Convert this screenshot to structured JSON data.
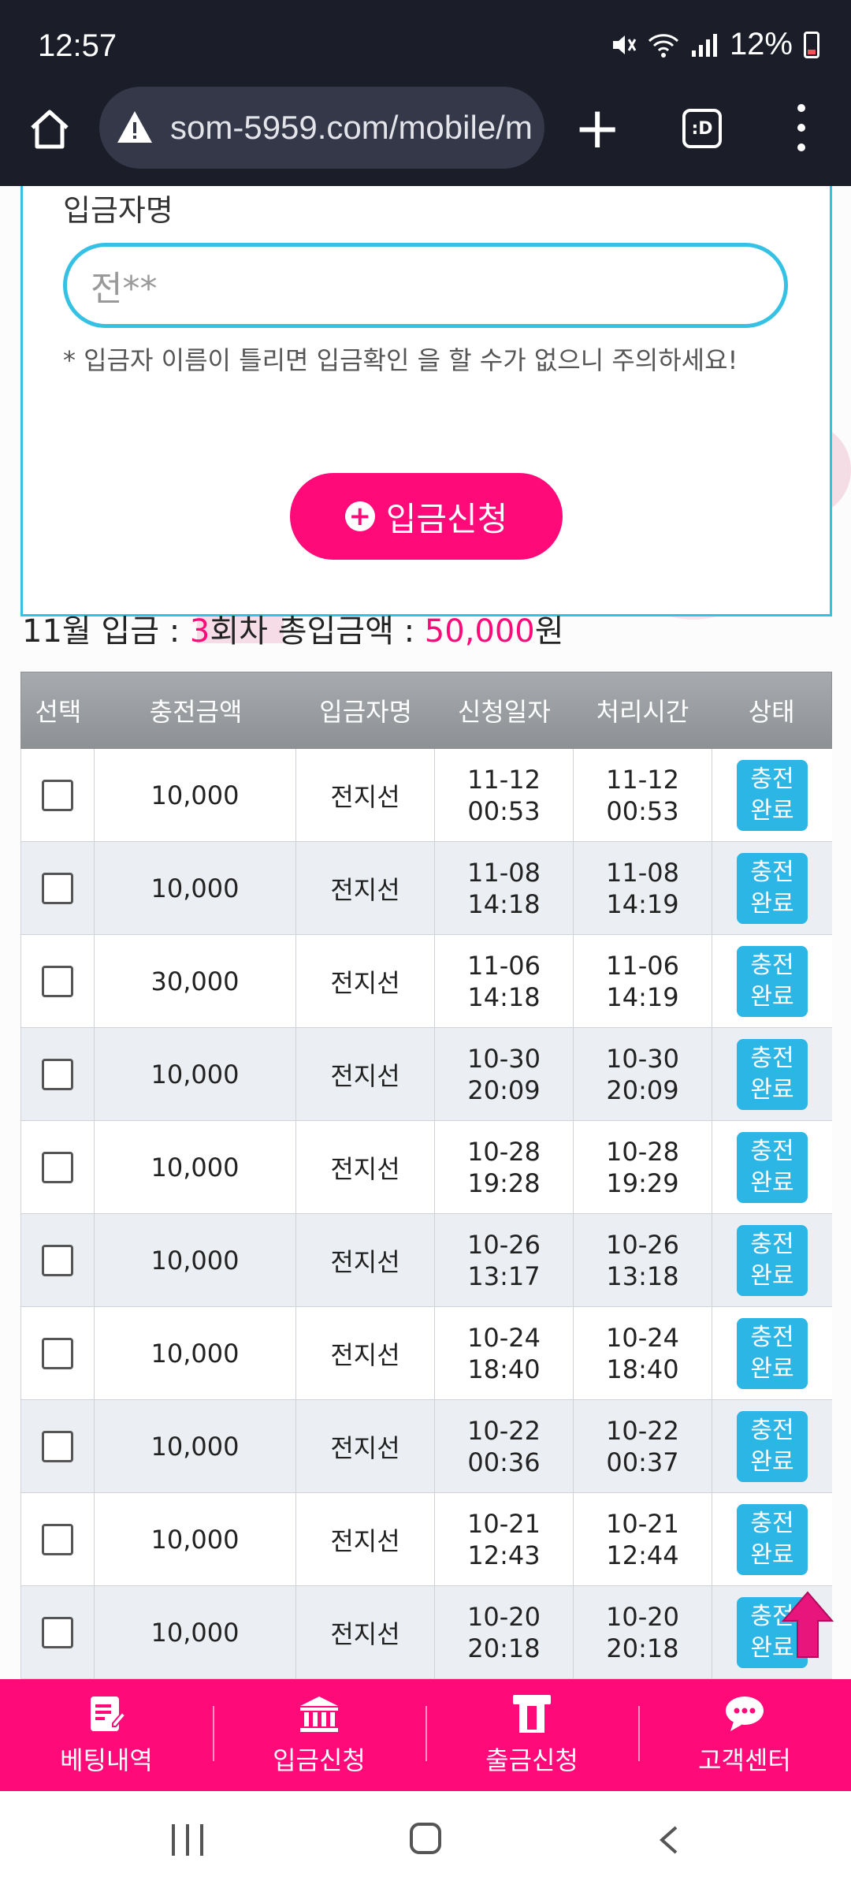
{
  "status_bar": {
    "time": "12:57",
    "battery": "12%"
  },
  "browser": {
    "url": "som-5959.com/mobile/m",
    "tab_label": ":D"
  },
  "form": {
    "label": "입금자명",
    "name_value": "전**",
    "warning": "* 입금자 이름이 틀리면 입금확인 을 할 수가 없으니 주의하세요!"
  },
  "deposit_button": "입금신청",
  "summary": {
    "prefix": "11월 입금 : ",
    "count": "3",
    "mid": "회차 총입금액 : ",
    "amount": "50,000",
    "suffix": "원"
  },
  "table": {
    "headers": [
      "선택",
      "충전금액",
      "입금자명",
      "신청일자",
      "처리시간",
      "상태"
    ],
    "rows": [
      {
        "amount": "10,000",
        "name": "전지선",
        "req_date": "11-12",
        "req_time": "00:53",
        "proc_date": "11-12",
        "proc_time": "00:53",
        "status_1": "충전",
        "status_2": "완료"
      },
      {
        "amount": "10,000",
        "name": "전지선",
        "req_date": "11-08",
        "req_time": "14:18",
        "proc_date": "11-08",
        "proc_time": "14:19",
        "status_1": "충전",
        "status_2": "완료"
      },
      {
        "amount": "30,000",
        "name": "전지선",
        "req_date": "11-06",
        "req_time": "14:18",
        "proc_date": "11-06",
        "proc_time": "14:19",
        "status_1": "충전",
        "status_2": "완료"
      },
      {
        "amount": "10,000",
        "name": "전지선",
        "req_date": "10-30",
        "req_time": "20:09",
        "proc_date": "10-30",
        "proc_time": "20:09",
        "status_1": "충전",
        "status_2": "완료"
      },
      {
        "amount": "10,000",
        "name": "전지선",
        "req_date": "10-28",
        "req_time": "19:28",
        "proc_date": "10-28",
        "proc_time": "19:29",
        "status_1": "충전",
        "status_2": "완료"
      },
      {
        "amount": "10,000",
        "name": "전지선",
        "req_date": "10-26",
        "req_time": "13:17",
        "proc_date": "10-26",
        "proc_time": "13:18",
        "status_1": "충전",
        "status_2": "완료"
      },
      {
        "amount": "10,000",
        "name": "전지선",
        "req_date": "10-24",
        "req_time": "18:40",
        "proc_date": "10-24",
        "proc_time": "18:40",
        "status_1": "충전",
        "status_2": "완료"
      },
      {
        "amount": "10,000",
        "name": "전지선",
        "req_date": "10-22",
        "req_time": "00:36",
        "proc_date": "10-22",
        "proc_time": "00:37",
        "status_1": "충전",
        "status_2": "완료"
      },
      {
        "amount": "10,000",
        "name": "전지선",
        "req_date": "10-21",
        "req_time": "12:43",
        "proc_date": "10-21",
        "proc_time": "12:44",
        "status_1": "충전",
        "status_2": "완료"
      },
      {
        "amount": "10,000",
        "name": "전지선",
        "req_date": "10-20",
        "req_time": "20:18",
        "proc_date": "10-20",
        "proc_time": "20:18",
        "status_1": "충전",
        "status_2": "완료"
      }
    ]
  },
  "bottom_nav": [
    {
      "label": "베팅내역",
      "icon": "notepad-icon"
    },
    {
      "label": "입금신청",
      "icon": "bank-icon"
    },
    {
      "label": "출금신청",
      "icon": "atm-icon"
    },
    {
      "label": "고객센터",
      "icon": "chat-icon"
    }
  ],
  "colors": {
    "accent_pink": "#ff0a78",
    "accent_cyan": "#35c1e4",
    "status_badge": "#2bb6e6",
    "header_gray": "#9a9ea2"
  }
}
